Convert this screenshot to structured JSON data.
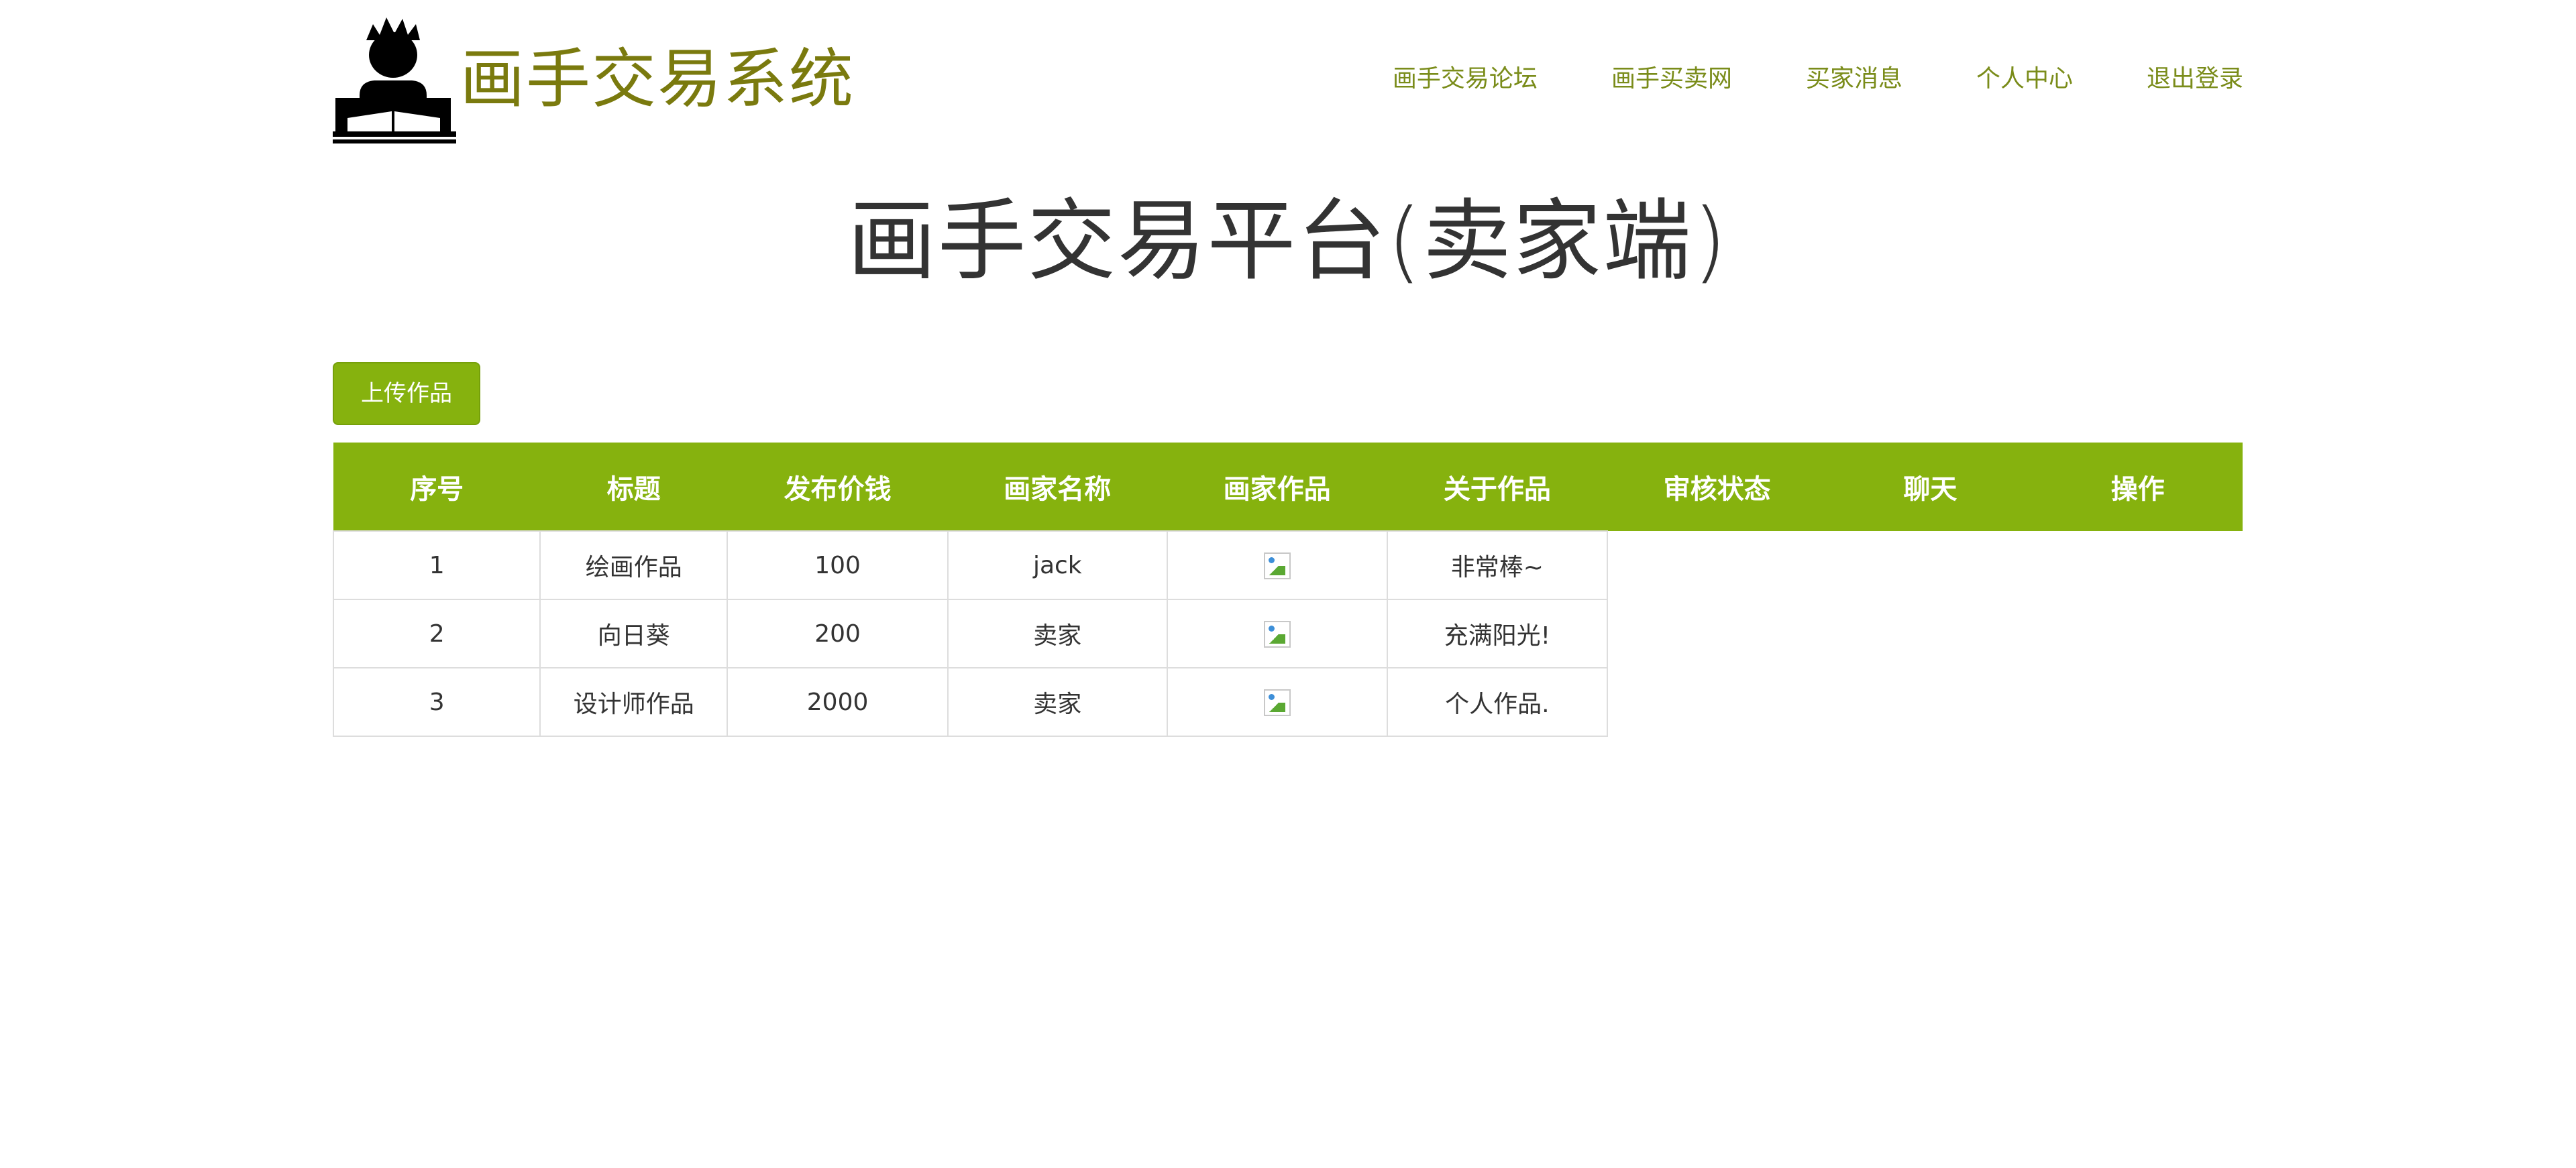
{
  "header": {
    "brand": "画手交易系统",
    "logo_icon": "reader-person-icon",
    "nav": [
      {
        "label": "画手交易论坛"
      },
      {
        "label": "画手买卖网"
      },
      {
        "label": "买家消息"
      },
      {
        "label": "个人中心"
      },
      {
        "label": "退出登录"
      }
    ]
  },
  "main": {
    "title": "画手交易平台(卖家端)",
    "upload_label": "上传作品",
    "table": {
      "columns": [
        "序号",
        "标题",
        "发布价钱",
        "画家名称",
        "画家作品",
        "关于作品",
        "审核状态",
        "聊天",
        "操作"
      ],
      "rows": [
        {
          "index": "1",
          "title": "绘画作品",
          "price": "100",
          "artist": "jack",
          "image_icon": "broken-image-icon",
          "about": "非常棒~"
        },
        {
          "index": "2",
          "title": "向日葵",
          "price": "200",
          "artist": "卖家",
          "image_icon": "broken-image-icon",
          "about": "充满阳光!"
        },
        {
          "index": "3",
          "title": "设计师作品",
          "price": "2000",
          "artist": "卖家",
          "image_icon": "broken-image-icon",
          "about": "个人作品."
        }
      ]
    }
  },
  "colors": {
    "brand_text": "#7a7a0e",
    "nav_text": "#7a8c1a",
    "accent_green": "#86b20e",
    "border": "#dddddd"
  }
}
